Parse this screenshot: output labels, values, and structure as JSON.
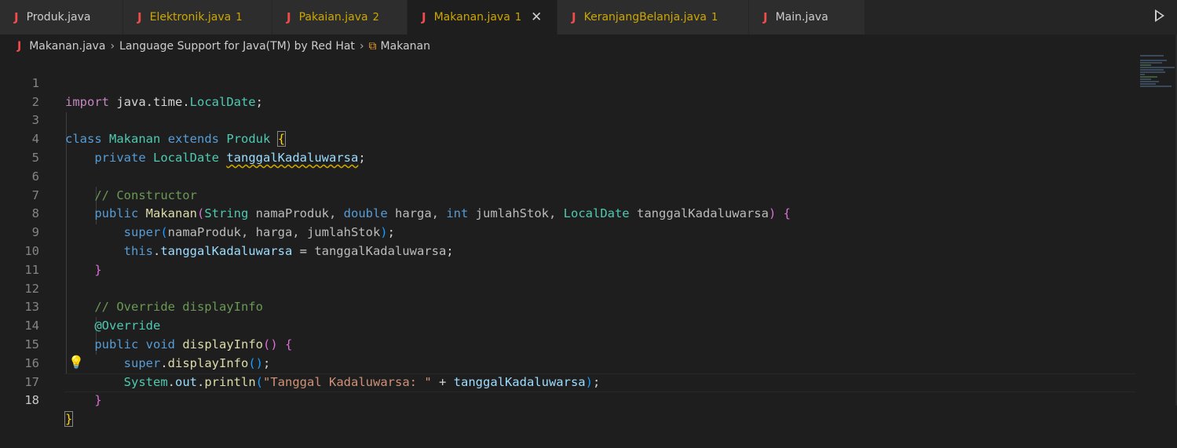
{
  "tabs": [
    {
      "name": "Produk.java",
      "count": "",
      "color": "#cccccc",
      "active": false
    },
    {
      "name": "Elektronik.java",
      "count": "1",
      "color": "#cca700",
      "active": false
    },
    {
      "name": "Pakaian.java",
      "count": "2",
      "color": "#cca700",
      "active": false
    },
    {
      "name": "Makanan.java",
      "count": "1",
      "color": "#cca700",
      "active": true
    },
    {
      "name": "KeranjangBelanja.java",
      "count": "1",
      "color": "#cca700",
      "active": false
    },
    {
      "name": "Main.java",
      "count": "",
      "color": "#cccccc",
      "active": false
    }
  ],
  "tab_icon_letter": "J",
  "close_glyph": "✕",
  "breadcrumb": {
    "file": "Makanan.java",
    "project": "Language Support for Java(TM) by Red Hat",
    "symbol": "Makanan",
    "separator": "›"
  },
  "line_numbers": [
    "1",
    "2",
    "3",
    "4",
    "5",
    "6",
    "7",
    "8",
    "9",
    "10",
    "11",
    "12",
    "13",
    "14",
    "15",
    "16",
    "17",
    "18"
  ],
  "code": {
    "l1": [
      "import",
      " java.time.",
      "LocalDate",
      ";"
    ],
    "l3": [
      "class",
      " ",
      "Makanan",
      " ",
      "extends",
      " ",
      "Produk",
      " ",
      "{"
    ],
    "l4": [
      "private",
      " ",
      "LocalDate",
      " ",
      "tanggalKadaluwarsa",
      ";"
    ],
    "l6": "// Constructor",
    "l7": [
      "public",
      " ",
      "Makanan",
      "(",
      "String",
      " namaProduk, ",
      "double",
      " harga, ",
      "int",
      " jumlahStok, ",
      "LocalDate",
      " tanggalKadaluwarsa",
      ")",
      " ",
      "{"
    ],
    "l8": [
      "super",
      "(",
      "namaProduk, harga, jumlahStok",
      ")",
      ";"
    ],
    "l9": [
      "this",
      ".",
      "tanggalKadaluwarsa",
      " = ",
      "tanggalKadaluwarsa",
      ";"
    ],
    "l10": "}",
    "l12": "// Override displayInfo",
    "l13": "@Override",
    "l14": [
      "public",
      " ",
      "void",
      " ",
      "displayInfo",
      "()",
      " ",
      "{"
    ],
    "l15": [
      "super",
      ".",
      "displayInfo",
      "()",
      ";"
    ],
    "l16": [
      "System",
      ".",
      "out",
      ".",
      "println",
      "(",
      "\"Tanggal Kadaluwarsa: \"",
      " + ",
      "tanggalKadaluwarsa",
      ")",
      ";"
    ],
    "l17": "}",
    "l18": "}"
  },
  "icons": {
    "tab_file": "java-file-icon",
    "run": "run-icon",
    "lightbulb": "lightbulb-icon",
    "class_symbol": "class-symbol-icon"
  }
}
